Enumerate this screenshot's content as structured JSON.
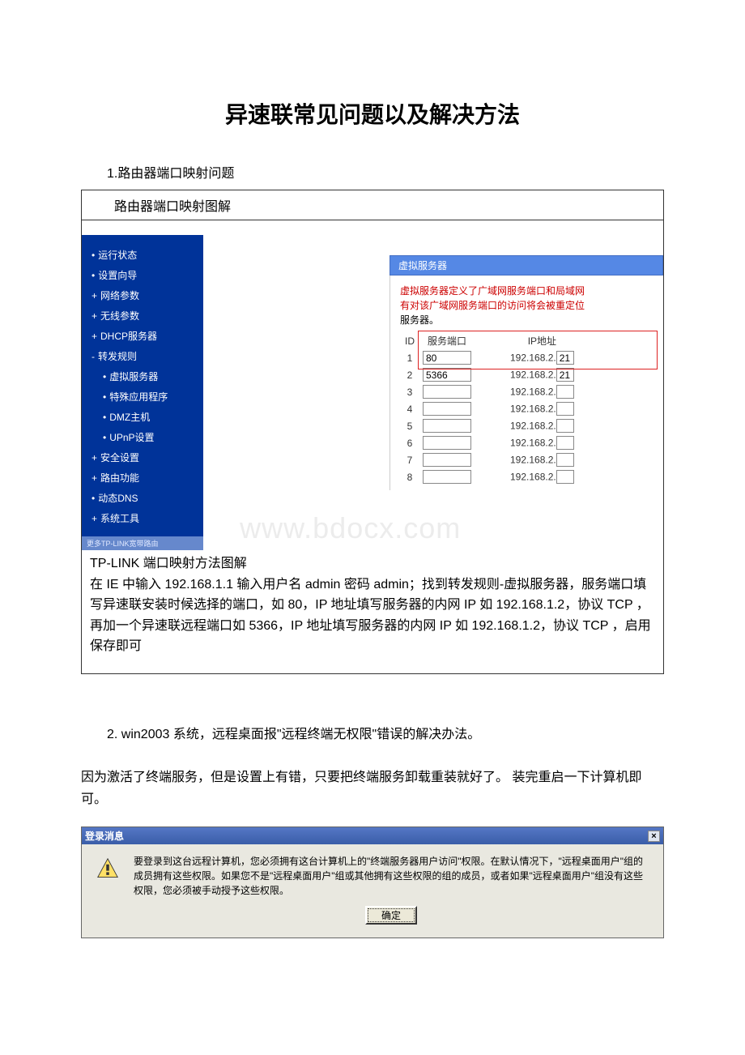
{
  "title": "异速联常见问题以及解决方法",
  "section1_heading": "1.路由器端口映射问题",
  "figure1_caption": "路由器端口映射图解",
  "router_menu": [
    {
      "label": "运行状态",
      "bullet": "•",
      "sub": false
    },
    {
      "label": "设置向导",
      "bullet": "•",
      "sub": false
    },
    {
      "label": "网络参数",
      "bullet": "+",
      "sub": false
    },
    {
      "label": "无线参数",
      "bullet": "+",
      "sub": false
    },
    {
      "label": "DHCP服务器",
      "bullet": "+",
      "sub": false
    },
    {
      "label": "转发规则",
      "bullet": "-",
      "sub": false
    },
    {
      "label": "虚拟服务器",
      "bullet": "•",
      "sub": true
    },
    {
      "label": "特殊应用程序",
      "bullet": "•",
      "sub": true
    },
    {
      "label": "DMZ主机",
      "bullet": "•",
      "sub": true
    },
    {
      "label": "UPnP设置",
      "bullet": "•",
      "sub": true
    },
    {
      "label": "安全设置",
      "bullet": "+",
      "sub": false
    },
    {
      "label": "路由功能",
      "bullet": "+",
      "sub": false
    },
    {
      "label": "动态DNS",
      "bullet": "•",
      "sub": false
    },
    {
      "label": "系统工具",
      "bullet": "+",
      "sub": false
    }
  ],
  "router_footer": "更多TP-LINK宽带路由",
  "vs_title": "虚拟服务器",
  "vs_note_line1": "虚拟服务器定义了广域网服务端口和局域网",
  "vs_note_line2": "有对该广域网服务端口的访问将会被重定位",
  "vs_note_line3": "服务器。",
  "vs_th_id": "ID",
  "vs_th_port": "服务端口",
  "vs_th_ip": "IP地址",
  "ip_prefix": "192.168.2.",
  "vs_rows": [
    {
      "id": "1",
      "port": "80",
      "ip_suffix": "21"
    },
    {
      "id": "2",
      "port": "5366",
      "ip_suffix": "21"
    },
    {
      "id": "3",
      "port": "",
      "ip_suffix": ""
    },
    {
      "id": "4",
      "port": "",
      "ip_suffix": ""
    },
    {
      "id": "5",
      "port": "",
      "ip_suffix": ""
    },
    {
      "id": "6",
      "port": "",
      "ip_suffix": ""
    },
    {
      "id": "7",
      "port": "",
      "ip_suffix": ""
    },
    {
      "id": "8",
      "port": "",
      "ip_suffix": ""
    }
  ],
  "watermark_text": "www.bdocx.com",
  "tplink_line1": "TP-LINK 端口映射方法图解",
  "tplink_line2": "在 IE 中输入 192.168.1.1 输入用户名 admin 密码 admin；找到转发规则-虚拟服务器，服务端口填写异速联安装时候选择的端口，如 80，IP 地址填写服务器的内网 IP 如 192.168.1.2，协议 TCP ，再加一个异速联远程端口如 5366，IP 地址填写服务器的内网 IP 如 192.168.1.2，协议 TCP ，启用保存即可",
  "section2_heading": "2. win2003 系统，远程桌面报\"远程终端无权限\"错误的解决办法。",
  "section2_para": "因为激活了终端服务，但是设置上有错，只要把终端服务卸载重装就好了。 装完重启一下计算机即可。",
  "login_title": "登录消息",
  "login_text": "要登录到这台远程计算机，您必须拥有这台计算机上的\"终端服务器用户访问\"权限。在默认情况下，\"远程桌面用户\"组的成员拥有这些权限。如果您不是\"远程桌面用户\"组或其他拥有这些权限的组的成员，或者如果\"远程桌面用户\"组没有这些权限，您必须被手动授予这些权限。",
  "login_ok": "确定",
  "close_x": "×"
}
